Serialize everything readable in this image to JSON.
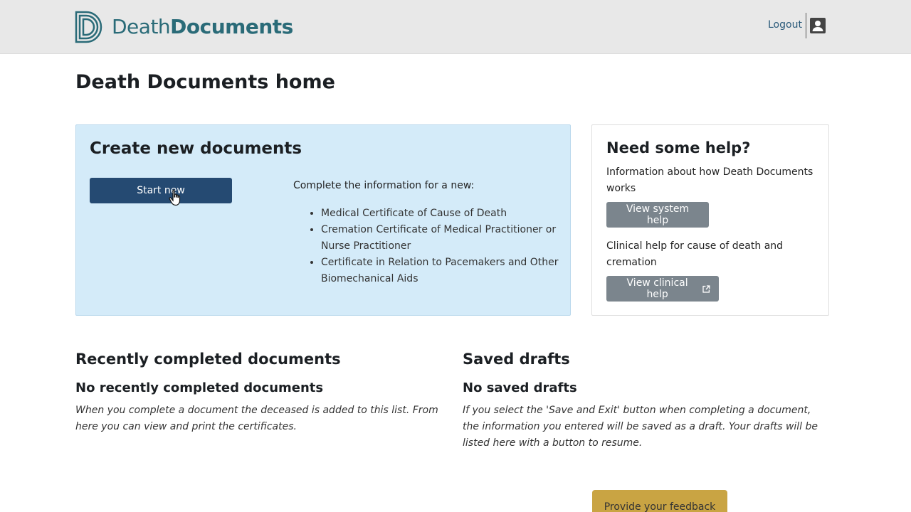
{
  "header": {
    "logo_light": "Death",
    "logo_bold": "Documents",
    "logout_label": "Logout"
  },
  "page_title": "Death Documents home",
  "create": {
    "title": "Create new documents",
    "start_label": "Start new",
    "intro": "Complete the information for a new:",
    "items": [
      "Medical Certificate of Cause of Death",
      "Cremation Certificate of Medical Practitioner or Nurse Practitioner",
      "Certificate in Relation to Pacemakers and Other Biomechanical Aids"
    ]
  },
  "help": {
    "title": "Need some help?",
    "system_text": "Information about how Death Documents works",
    "system_button": "View system help",
    "clinical_text": "Clinical help for cause of death and cremation",
    "clinical_button": "View clinical help"
  },
  "recent": {
    "title": "Recently completed documents",
    "empty_title": "No recently completed documents",
    "empty_desc": "When you complete a document the deceased is added to this list. From here you can view and print the certificates."
  },
  "drafts": {
    "title": "Saved drafts",
    "empty_title": "No saved drafts",
    "empty_desc": "If you select the 'Save and Exit' button when completing a document, the information you entered will be saved as a draft. Your drafts will be listed here with a button to resume."
  },
  "feedback_label": "Provide your feedback",
  "colors": {
    "brand": "#2a6b78",
    "primary_button": "#254a72",
    "secondary_button": "#7b858d",
    "panel_bg": "#d4ebf9",
    "feedback_bg": "#c9a443"
  },
  "icons": {
    "logo": "d-logo-icon",
    "user": "user-icon",
    "external": "external-link-icon",
    "cursor": "hand-pointer-icon"
  }
}
